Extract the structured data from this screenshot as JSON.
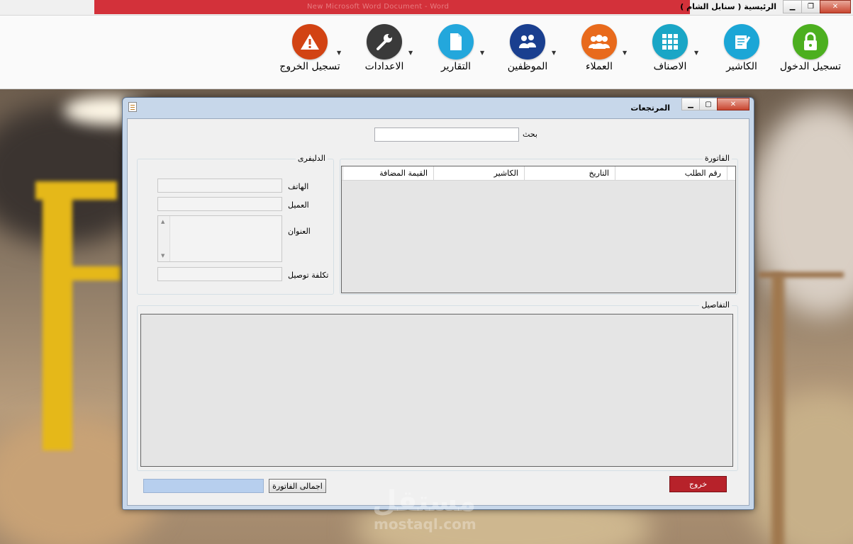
{
  "app": {
    "title": "الرئيسية ( سنابل الشام )",
    "background_caption": "New Microsoft Word Document - Word"
  },
  "toolbar": [
    {
      "id": "login",
      "label": "تسجيل الدخول",
      "icon": "lock-icon",
      "color": "#4caf1f",
      "dropdown": false
    },
    {
      "id": "cashier",
      "label": "الكاشير",
      "icon": "notepad-icon",
      "color": "#1ba6d6",
      "dropdown": true
    },
    {
      "id": "items",
      "label": "الاصناف",
      "icon": "grid-icon",
      "color": "#1aa6c6",
      "dropdown": true
    },
    {
      "id": "customers",
      "label": "العملاء",
      "icon": "people-icon",
      "color": "#e86a1c",
      "dropdown": true
    },
    {
      "id": "employees",
      "label": "الموظفين",
      "icon": "employees-icon",
      "color": "#1a3f8f",
      "dropdown": true
    },
    {
      "id": "reports",
      "label": "التقارير",
      "icon": "document-icon",
      "color": "#23a7dc",
      "dropdown": true
    },
    {
      "id": "settings",
      "label": "الاعدادات",
      "icon": "wrench-icon",
      "color": "#3a3a3a",
      "dropdown": true
    },
    {
      "id": "logout",
      "label": "تسجيل الخروج",
      "icon": "warning-icon",
      "color": "#d24313",
      "dropdown": false
    }
  ],
  "window": {
    "title": "المرتجعات",
    "search": {
      "label": "بحث",
      "value": ""
    },
    "invoice_group": {
      "caption": "الفاتورة",
      "columns": [
        "رقم الطلب",
        "التاريخ",
        "الكاشير",
        "القيمة المضافة"
      ]
    },
    "delivery_group": {
      "caption": "الدليفرى",
      "phone_label": "الهاتف",
      "customer_label": "العميل",
      "address_label": "العنوان",
      "delivery_cost_label": "تكلفة توصيل",
      "phone_value": "",
      "customer_value": "",
      "address_value": "",
      "delivery_cost_value": ""
    },
    "details_group": {
      "caption": "التفاصيل"
    },
    "exit_button": "خروج",
    "total_button": "اجمالى الفاتورة",
    "total_value": ""
  },
  "watermark": {
    "main": "مستقل",
    "sub": "mostaql.com"
  }
}
